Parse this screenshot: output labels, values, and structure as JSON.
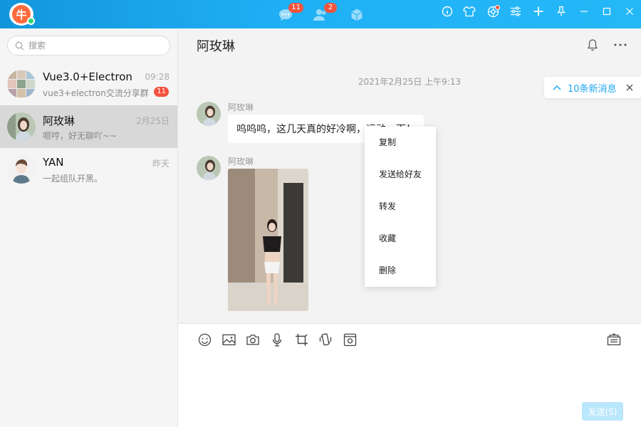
{
  "titlebar": {
    "logo_glyph": "牛",
    "nav": [
      {
        "icon": "chat-bubble-icon",
        "badge": "11"
      },
      {
        "icon": "contacts-icon",
        "badge": "2"
      },
      {
        "icon": "cube-icon",
        "badge": ""
      }
    ],
    "tools": [
      "info-icon",
      "tshirt-icon",
      "aperture-icon",
      "sliders-icon",
      "plus-icon",
      "pin-icon",
      "minimize-icon",
      "maximize-icon",
      "close-icon"
    ],
    "accent_color": "#1ea7f2"
  },
  "sidebar": {
    "search_placeholder": "搜索",
    "conversations": [
      {
        "name": "Vue3.0+Electron",
        "time": "09:28",
        "preview": "vue3+electron交流分享群",
        "unread": "11",
        "avatar": "group-avatar"
      },
      {
        "name": "阿玫琳",
        "time": "2月25日",
        "preview": "嗯哼，好无聊吖~~",
        "unread": "",
        "avatar": "girl-avatar",
        "active": true
      },
      {
        "name": "YAN",
        "time": "昨天",
        "preview": "一起组队开黑。",
        "unread": "",
        "avatar": "boy-avatar"
      }
    ]
  },
  "chat": {
    "title": "阿玫琳",
    "date_divider": "2021年2月25日 上午9:13",
    "new_messages": "10条新消息",
    "messages": [
      {
        "sender": "阿玫琳",
        "type": "text",
        "text": "呜呜呜，这几天真的好冷啊，运动一下！"
      },
      {
        "sender": "阿玫琳",
        "type": "image",
        "alt": "photo"
      }
    ]
  },
  "context_menu": [
    "复制",
    "发送给好友",
    "转发",
    "收藏",
    "删除"
  ],
  "input": {
    "toolbar": [
      "emoji-icon",
      "image-icon",
      "camera-icon",
      "microphone-icon",
      "crop-icon",
      "shake-icon",
      "screen-record-icon"
    ],
    "history_icon": "chat-history-icon",
    "send_label": "发送(S)"
  }
}
